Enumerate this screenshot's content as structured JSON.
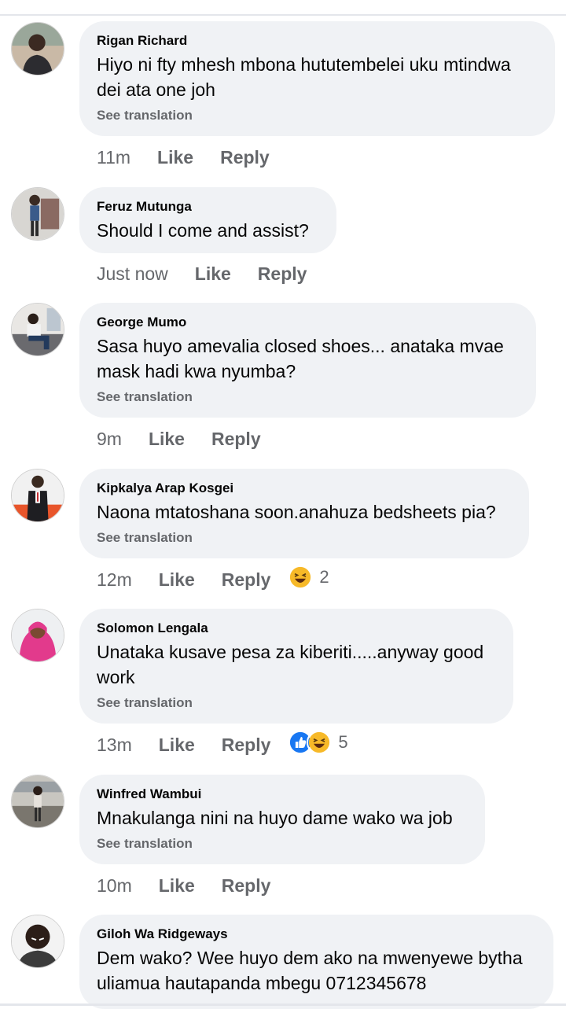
{
  "comments": [
    {
      "author": "Rigan Richard",
      "text": "Hiyo ni fty mhesh mbona hututembelei  uku mtindwa dei ata one joh",
      "translation_label": "See translation",
      "time": "11m",
      "like_label": "Like",
      "reply_label": "Reply"
    },
    {
      "author": "Feruz Mutunga",
      "text": "Should I come and assist?",
      "time": "Just now",
      "like_label": "Like",
      "reply_label": "Reply"
    },
    {
      "author": "George Mumo",
      "text": "Sasa huyo amevalia closed shoes... anataka mvae mask hadi kwa nyumba?",
      "translation_label": "See translation",
      "time": "9m",
      "like_label": "Like",
      "reply_label": "Reply"
    },
    {
      "author": "Kipkalya Arap Kosgei",
      "text": "Naona mtatoshana soon.anahuza bedsheets pia?",
      "translation_label": "See translation",
      "time": "12m",
      "like_label": "Like",
      "reply_label": "Reply",
      "reactions": {
        "icons": [
          "haha-icon"
        ],
        "count": "2"
      }
    },
    {
      "author": "Solomon Lengala",
      "text": "Unataka kusave pesa za kiberiti.....anyway good work",
      "translation_label": "See translation",
      "time": "13m",
      "like_label": "Like",
      "reply_label": "Reply",
      "reactions": {
        "icons": [
          "like-reaction-icon",
          "haha-icon"
        ],
        "count": "5"
      }
    },
    {
      "author": "Winfred Wambui",
      "text": "Mnakulanga nini na huyo dame wako wa job",
      "translation_label": "See translation",
      "time": "10m",
      "like_label": "Like",
      "reply_label": "Reply"
    },
    {
      "author": "Giloh Wa Ridgeways",
      "text": "Dem wako? Wee huyo dem ako na mwenyewe bytha uliamua hautapanda mbegu 0712345678"
    }
  ],
  "colors": {
    "bubble_bg": "#f0f2f5",
    "text_primary": "#050505",
    "text_secondary": "#65676b",
    "like_blue": "#1877f2",
    "haha_yellow": "#f7b928"
  }
}
